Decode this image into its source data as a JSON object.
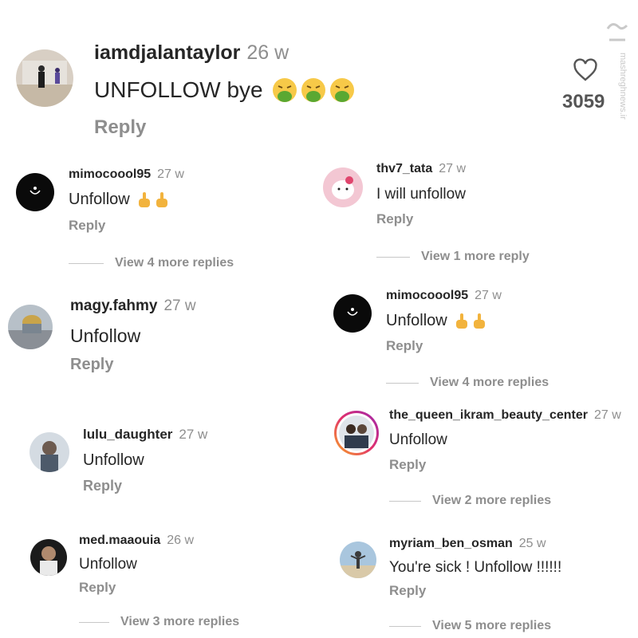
{
  "main": {
    "username": "iamdjalantaylor",
    "time": "26 w",
    "text": "UNFOLLOW bye",
    "reply_label": "Reply",
    "like_count": "3059"
  },
  "left": [
    {
      "username": "mimocoool95",
      "time": "27 w",
      "text": "Unfollow",
      "reply_label": "Reply",
      "more_label": "View 4 more replies"
    },
    {
      "username": "magy.fahmy",
      "time": "27 w",
      "text": "Unfollow",
      "reply_label": "Reply"
    },
    {
      "username": "lulu_daughter",
      "time": "27 w",
      "text": "Unfollow",
      "reply_label": "Reply"
    },
    {
      "username": "med.maaouia",
      "time": "26 w",
      "text": "Unfollow",
      "reply_label": "Reply",
      "more_label": "View 3 more replies"
    }
  ],
  "right": [
    {
      "username": "thv7_tata",
      "time": "27 w",
      "text": "I will unfollow",
      "reply_label": "Reply",
      "more_label": "View 1 more reply"
    },
    {
      "username": "mimocoool95",
      "time": "27 w",
      "text": "Unfollow",
      "reply_label": "Reply",
      "more_label": "View 4 more replies"
    },
    {
      "username": "the_queen_ikram_beauty_center",
      "time": "27 w",
      "text": "Unfollow",
      "reply_label": "Reply",
      "more_label": "View 2 more replies"
    },
    {
      "username": "myriam_ben_osman",
      "time": "25 w",
      "text": "You're sick ! Unfollow !!!!!!",
      "reply_label": "Reply",
      "more_label": "View 5 more replies"
    }
  ],
  "watermark": {
    "text": "mashreghnews.ir"
  },
  "colors": {
    "text": "#262626",
    "muted": "#8e8e8e",
    "divider": "#c7c7c7",
    "story_ring": "#d6249f"
  },
  "icons": {
    "like": "heart-outline-icon",
    "emoji_main": "nauseated-face-icon",
    "emoji_reply": "middle-finger-icon"
  }
}
